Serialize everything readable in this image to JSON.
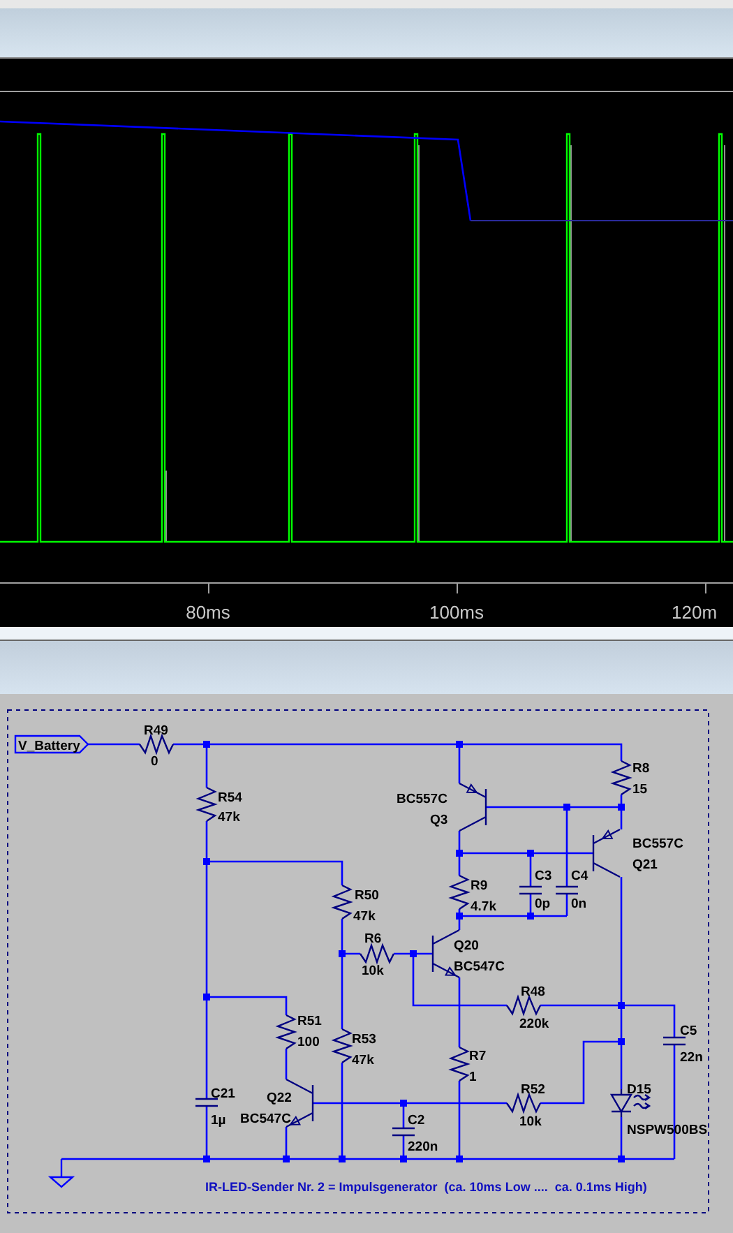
{
  "plot": {
    "x_ticks": [
      "80ms",
      "100ms",
      "120m"
    ]
  },
  "schematic": {
    "net_label": "V_Battery",
    "components": [
      {
        "kind": "resistor",
        "ref": "R49",
        "value": "0"
      },
      {
        "kind": "resistor",
        "ref": "R54",
        "value": "47k"
      },
      {
        "kind": "resistor",
        "ref": "R8",
        "value": "15"
      },
      {
        "kind": "pnp",
        "ref": "Q3",
        "value": "BC557C"
      },
      {
        "kind": "pnp",
        "ref": "Q21",
        "value": "BC557C"
      },
      {
        "kind": "resistor",
        "ref": "R50",
        "value": "47k"
      },
      {
        "kind": "resistor",
        "ref": "R9",
        "value": "4.7k"
      },
      {
        "kind": "capacitor",
        "ref": "C3",
        "value": "0p"
      },
      {
        "kind": "capacitor",
        "ref": "C4",
        "value": "0n"
      },
      {
        "kind": "resistor",
        "ref": "R6",
        "value": "10k"
      },
      {
        "kind": "npn",
        "ref": "Q20",
        "value": "BC547C"
      },
      {
        "kind": "resistor",
        "ref": "R48",
        "value": "220k"
      },
      {
        "kind": "capacitor",
        "ref": "C5",
        "value": "22n"
      },
      {
        "kind": "resistor",
        "ref": "R51",
        "value": "100"
      },
      {
        "kind": "resistor",
        "ref": "R53",
        "value": "47k"
      },
      {
        "kind": "resistor",
        "ref": "R7",
        "value": "1"
      },
      {
        "kind": "capacitor",
        "ref": "C21",
        "value": "1µ"
      },
      {
        "kind": "npn",
        "ref": "Q22",
        "value": "BC547C"
      },
      {
        "kind": "capacitor",
        "ref": "C2",
        "value": "220n"
      },
      {
        "kind": "resistor",
        "ref": "R52",
        "value": "10k"
      },
      {
        "kind": "diode",
        "ref": "D15",
        "value": "NSPW500BS"
      }
    ],
    "note": "IR-LED-Sender Nr. 2 = Impulsgenerator  (ca. 10ms Low ....  ca. 0.1ms High)"
  }
}
